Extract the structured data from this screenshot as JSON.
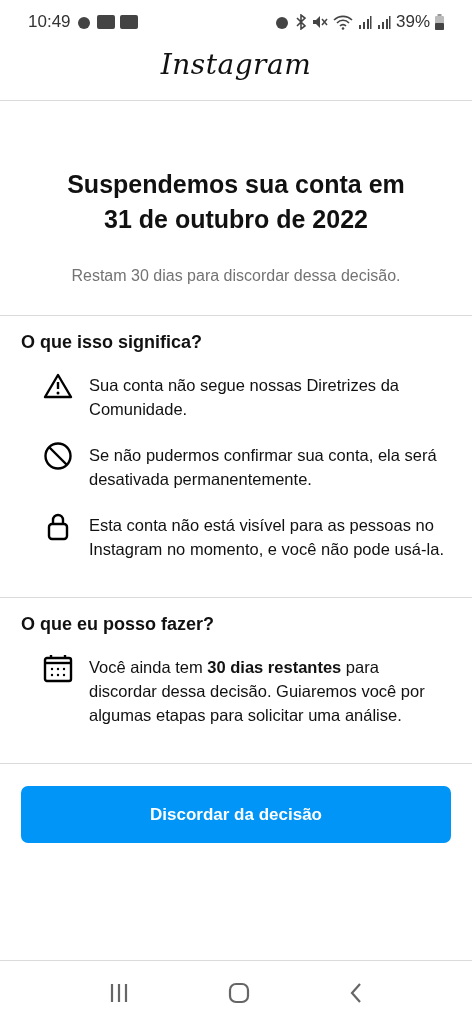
{
  "status_bar": {
    "time": "10:49",
    "battery": "39%"
  },
  "header": {
    "logo": "Instagram"
  },
  "hero": {
    "title": "Suspendemos sua conta em 31 de outubro de 2022",
    "subtitle": "Restam 30 dias para discordar dessa decisão."
  },
  "sections": [
    {
      "heading": "O que isso significa?",
      "items": [
        {
          "kind": "warning",
          "text": "Sua conta não segue nossas Diretrizes da Comunidade."
        },
        {
          "kind": "prohibited",
          "text": "Se não pudermos confirmar sua conta, ela será desativada permanentemente."
        },
        {
          "kind": "lock",
          "text": "Esta conta não está visível para as pessoas no Instagram no momento, e você não pode usá-la."
        }
      ]
    },
    {
      "heading": "O que eu posso fazer?",
      "items": [
        {
          "kind": "calendar",
          "text": "Você ainda tem **30 dias restantes** para discordar dessa decisão. Guiaremos você por algumas etapas para solicitar uma análise."
        }
      ]
    }
  ],
  "action_button": "Discordar da decisão"
}
